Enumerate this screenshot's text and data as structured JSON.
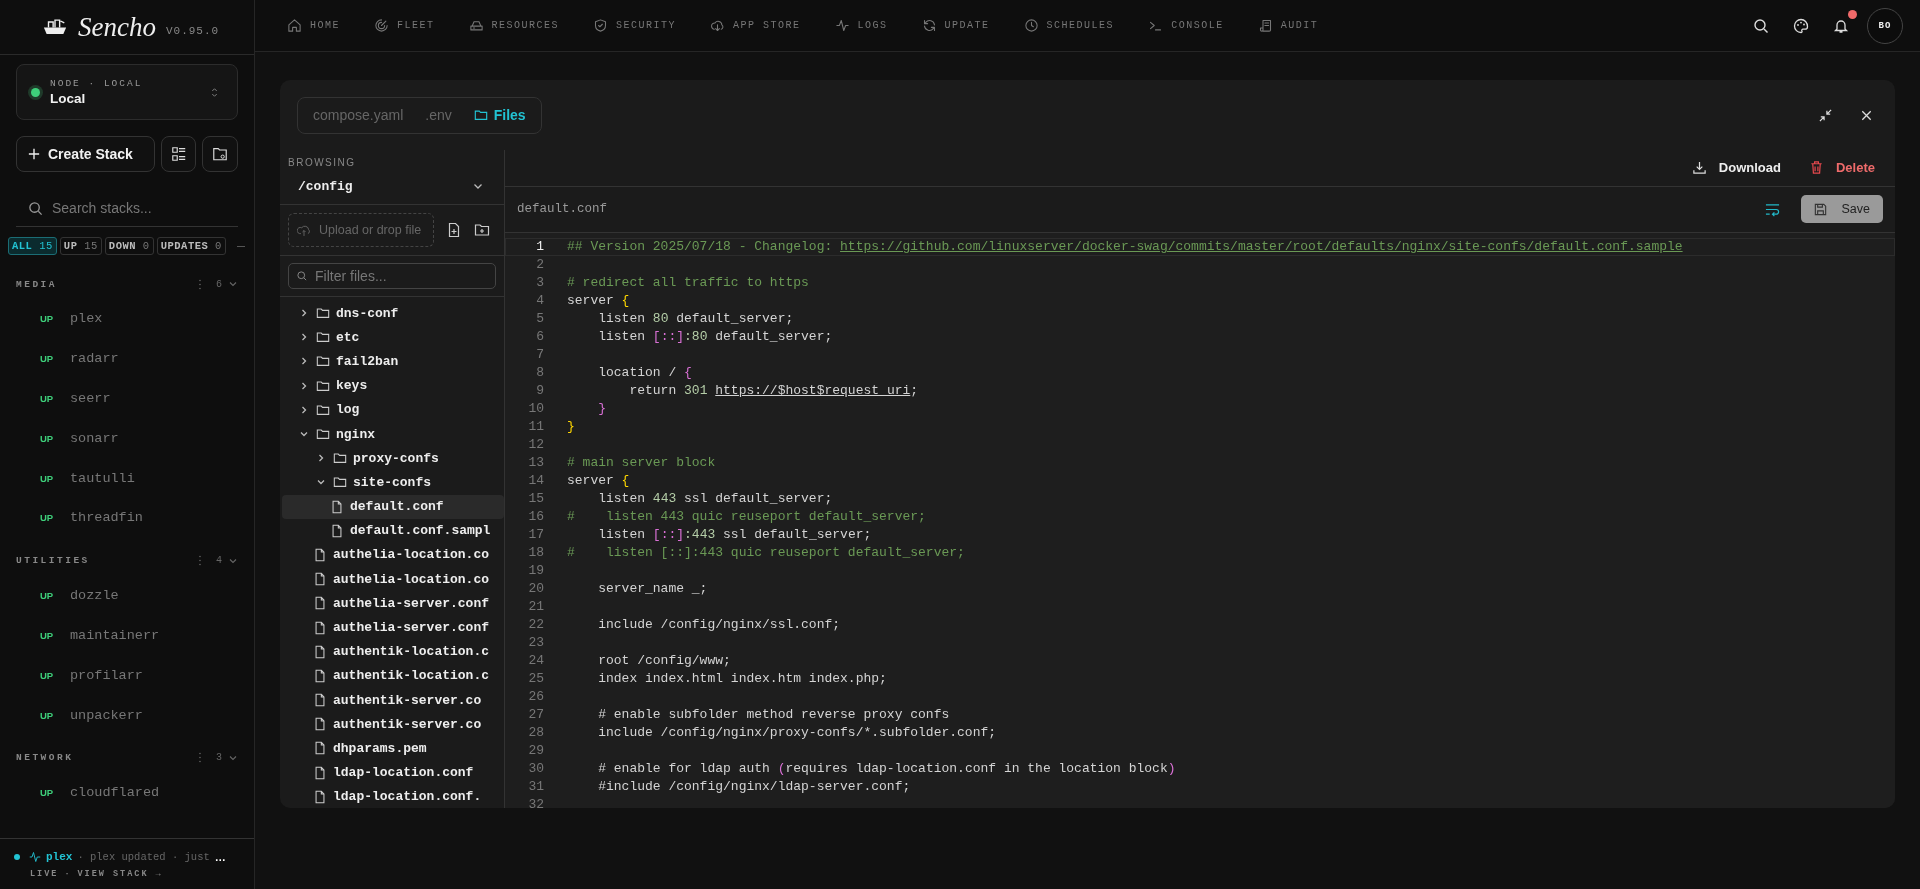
{
  "sidebar": {
    "brand": "Sencho",
    "version": "V0.95.0",
    "node": {
      "label": "NODE · LOCAL",
      "name": "Local",
      "online": true
    },
    "create_button": "Create Stack",
    "search": {
      "placeholder": "Search stacks..."
    },
    "filters": [
      {
        "label": "ALL",
        "count": "15",
        "selected": true
      },
      {
        "label": "UP",
        "count": "15",
        "selected": false
      },
      {
        "label": "DOWN",
        "count": "0",
        "selected": false
      },
      {
        "label": "UPDATES",
        "count": "0",
        "selected": false
      }
    ],
    "groups": [
      {
        "name": "MEDIA",
        "count": "6",
        "items": [
          {
            "status": "UP",
            "healthy": true,
            "name": "plex"
          },
          {
            "status": "UP",
            "healthy": true,
            "name": "radarr"
          },
          {
            "status": "UP",
            "healthy": true,
            "name": "seerr"
          },
          {
            "status": "UP",
            "healthy": true,
            "name": "sonarr"
          },
          {
            "status": "UP",
            "healthy": true,
            "name": "tautulli"
          },
          {
            "status": "UP",
            "healthy": true,
            "name": "threadfin"
          }
        ]
      },
      {
        "name": "UTILITIES",
        "count": "4",
        "items": [
          {
            "status": "UP",
            "healthy": true,
            "name": "dozzle"
          },
          {
            "status": "UP",
            "healthy": true,
            "name": "maintainerr"
          },
          {
            "status": "UP",
            "healthy": true,
            "name": "profilarr"
          },
          {
            "status": "UP",
            "healthy": true,
            "name": "unpackerr"
          }
        ]
      },
      {
        "name": "NETWORK",
        "count": "3",
        "items": [
          {
            "status": "UP",
            "healthy": true,
            "name": "cloudflared"
          }
        ]
      }
    ],
    "activity": {
      "live": true,
      "stack": "plex",
      "message": "· plex updated · just",
      "more": "…",
      "status_label": "LIVE",
      "separator": "·",
      "link": "VIEW STACK →"
    }
  },
  "nav": {
    "items": [
      "HOME",
      "FLEET",
      "RESOURCES",
      "SECURITY",
      "APP STORE",
      "LOGS",
      "UPDATE",
      "SCHEDULES",
      "CONSOLE",
      "AUDIT"
    ],
    "notifications_unread": true,
    "avatar": "BO"
  },
  "panel": {
    "tabs": [
      {
        "label": "compose.yaml",
        "selected": false
      },
      {
        "label": ".env",
        "selected": false
      },
      {
        "label": "Files",
        "selected": true
      }
    ],
    "browser": {
      "heading": "BROWSING",
      "path": "/config",
      "upload": "Upload or drop file",
      "filter_placeholder": "Filter files...",
      "tree": [
        {
          "kind": "folder",
          "name": "dns-conf",
          "expanded": false,
          "selected": false
        },
        {
          "kind": "folder",
          "name": "etc",
          "expanded": false,
          "selected": false
        },
        {
          "kind": "folder",
          "name": "fail2ban",
          "expanded": false,
          "selected": false
        },
        {
          "kind": "folder",
          "name": "keys",
          "expanded": false,
          "selected": false
        },
        {
          "kind": "folder",
          "name": "log",
          "expanded": false,
          "selected": false
        },
        {
          "kind": "folder",
          "name": "nginx",
          "expanded": true,
          "selected": false,
          "children": [
            {
              "kind": "folder",
              "name": "proxy-confs",
              "expanded": false,
              "selected": false
            },
            {
              "kind": "folder",
              "name": "site-confs",
              "expanded": true,
              "selected": false,
              "children": [
                {
                  "kind": "file",
                  "name": "default.conf",
                  "selected": true
                },
                {
                  "kind": "file",
                  "name": "default.conf.sampl",
                  "selected": false
                }
              ]
            },
            {
              "kind": "file",
              "name": "authelia-location.co",
              "selected": false
            },
            {
              "kind": "file",
              "name": "authelia-location.co",
              "selected": false
            },
            {
              "kind": "file",
              "name": "authelia-server.conf",
              "selected": false
            },
            {
              "kind": "file",
              "name": "authelia-server.conf",
              "selected": false
            },
            {
              "kind": "file",
              "name": "authentik-location.c",
              "selected": false
            },
            {
              "kind": "file",
              "name": "authentik-location.c",
              "selected": false
            },
            {
              "kind": "file",
              "name": "authentik-server.co",
              "selected": false
            },
            {
              "kind": "file",
              "name": "authentik-server.co",
              "selected": false
            },
            {
              "kind": "file",
              "name": "dhparams.pem",
              "selected": false
            },
            {
              "kind": "file",
              "name": "ldap-location.conf",
              "selected": false
            },
            {
              "kind": "file",
              "name": "ldap-location.conf.",
              "selected": false
            }
          ]
        }
      ]
    },
    "editor": {
      "download": "Download",
      "delete": "Delete",
      "filename": "default.conf",
      "wrap_on": true,
      "save": {
        "label": "Save",
        "disabled": true
      },
      "lines": [
        {
          "number": "1",
          "current": true,
          "tokens": [
            {
              "kind": "comment",
              "text": "## Version 2025/07/18 - Changelog: "
            },
            {
              "kind": "comment-link",
              "text": "https://github.com/linuxserver/docker-swag/commits/master/root/defaults/nginx/site-confs/default.conf.sample"
            }
          ]
        },
        {
          "number": "2",
          "current": false
        },
        {
          "number": "3",
          "current": false,
          "tokens": [
            {
              "kind": "comment",
              "text": "# redirect all traffic to https"
            }
          ]
        },
        {
          "number": "4",
          "current": false,
          "tokens": [
            {
              "kind": "text",
              "text": "server "
            },
            {
              "kind": "brace",
              "text": "{"
            }
          ]
        },
        {
          "number": "5",
          "current": false,
          "tokens": [
            {
              "kind": "text",
              "text": "    listen "
            },
            {
              "kind": "number",
              "text": "80"
            },
            {
              "kind": "text",
              "text": " default_server;"
            }
          ]
        },
        {
          "number": "6",
          "current": false,
          "tokens": [
            {
              "kind": "text",
              "text": "    listen "
            },
            {
              "kind": "bracket",
              "text": "[::]"
            },
            {
              "kind": "number",
              "text": ":80"
            },
            {
              "kind": "text",
              "text": " default_server;"
            }
          ]
        },
        {
          "number": "7",
          "current": false
        },
        {
          "number": "8",
          "current": false,
          "tokens": [
            {
              "kind": "text",
              "text": "    location / "
            },
            {
              "kind": "bracket",
              "text": "{"
            }
          ]
        },
        {
          "number": "9",
          "current": false,
          "tokens": [
            {
              "kind": "text",
              "text": "        return "
            },
            {
              "kind": "number",
              "text": "301 "
            },
            {
              "kind": "link",
              "text": "https://$host$request_uri"
            },
            {
              "kind": "text",
              "text": ";"
            }
          ]
        },
        {
          "number": "10",
          "current": false,
          "tokens": [
            {
              "kind": "bracket",
              "text": "    }"
            }
          ]
        },
        {
          "number": "11",
          "current": false,
          "tokens": [
            {
              "kind": "brace",
              "text": "}"
            }
          ]
        },
        {
          "number": "12",
          "current": false
        },
        {
          "number": "13",
          "current": false,
          "tokens": [
            {
              "kind": "comment",
              "text": "# main server block"
            }
          ]
        },
        {
          "number": "14",
          "current": false,
          "tokens": [
            {
              "kind": "text",
              "text": "server "
            },
            {
              "kind": "brace",
              "text": "{"
            }
          ]
        },
        {
          "number": "15",
          "current": false,
          "tokens": [
            {
              "kind": "text",
              "text": "    listen "
            },
            {
              "kind": "number",
              "text": "443"
            },
            {
              "kind": "text",
              "text": " ssl default_server;"
            }
          ]
        },
        {
          "number": "16",
          "current": false,
          "tokens": [
            {
              "kind": "comment",
              "text": "#    listen 443 quic reuseport default_server;"
            }
          ]
        },
        {
          "number": "17",
          "current": false,
          "tokens": [
            {
              "kind": "text",
              "text": "    listen "
            },
            {
              "kind": "bracket",
              "text": "[::]"
            },
            {
              "kind": "number",
              "text": ":443"
            },
            {
              "kind": "text",
              "text": " ssl default_server;"
            }
          ]
        },
        {
          "number": "18",
          "current": false,
          "tokens": [
            {
              "kind": "comment",
              "text": "#    listen [::]:443 quic reuseport default_server;"
            }
          ]
        },
        {
          "number": "19",
          "current": false
        },
        {
          "number": "20",
          "current": false,
          "tokens": [
            {
              "kind": "text",
              "text": "    server_name _;"
            }
          ]
        },
        {
          "number": "21",
          "current": false
        },
        {
          "number": "22",
          "current": false,
          "tokens": [
            {
              "kind": "text",
              "text": "    include /config/nginx/ssl.conf;"
            }
          ]
        },
        {
          "number": "23",
          "current": false
        },
        {
          "number": "24",
          "current": false,
          "tokens": [
            {
              "kind": "text",
              "text": "    root /config/www;"
            }
          ]
        },
        {
          "number": "25",
          "current": false,
          "tokens": [
            {
              "kind": "text",
              "text": "    index index.html index.htm index.php;"
            }
          ]
        },
        {
          "number": "26",
          "current": false
        },
        {
          "number": "27",
          "current": false,
          "tokens": [
            {
              "kind": "text",
              "text": "    # enable subfolder method reverse proxy confs"
            }
          ]
        },
        {
          "number": "28",
          "current": false,
          "tokens": [
            {
              "kind": "text",
              "text": "    include /config/nginx/proxy-confs/*.subfolder.conf;"
            }
          ]
        },
        {
          "number": "29",
          "current": false
        },
        {
          "number": "30",
          "current": false,
          "tokens": [
            {
              "kind": "text",
              "text": "    # enable for ldap auth "
            },
            {
              "kind": "bracket",
              "text": "("
            },
            {
              "kind": "text",
              "text": "requires ldap-location.conf in the location block"
            },
            {
              "kind": "bracket",
              "text": ")"
            }
          ]
        },
        {
          "number": "31",
          "current": false,
          "tokens": [
            {
              "kind": "text",
              "text": "    #include /config/nginx/ldap-server.conf;"
            }
          ]
        },
        {
          "number": "32",
          "current": false
        }
      ]
    }
  }
}
